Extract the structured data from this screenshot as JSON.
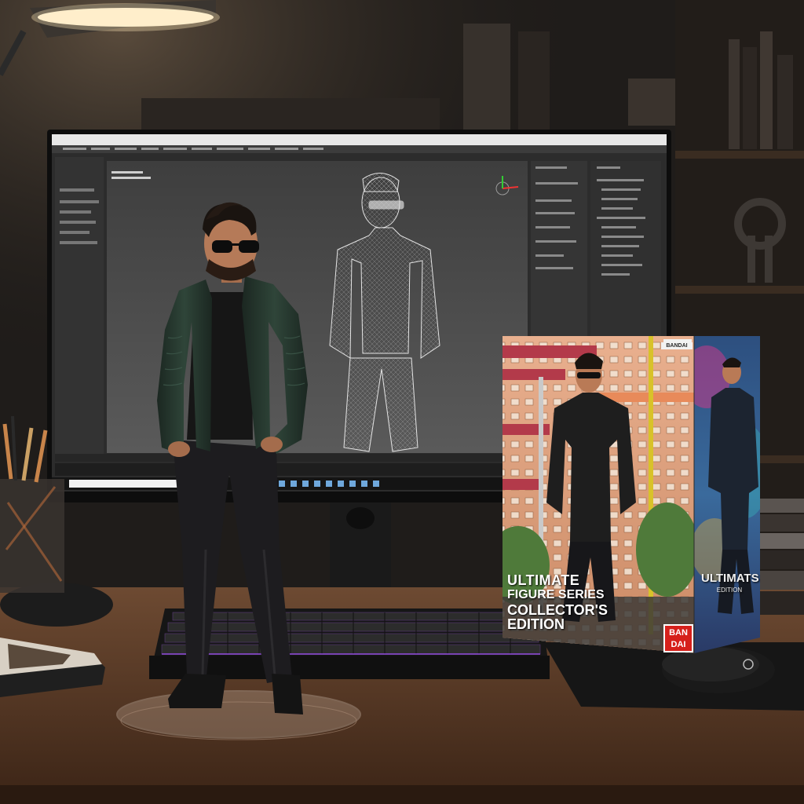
{
  "box": {
    "front_line_1": "ULTIMATE",
    "front_line_2": "FIGURE SERIES",
    "front_line_3": "COLLECTOR'S EDITION",
    "brand_line_1": "BAN",
    "brand_line_2": "DAI",
    "side_title": "ULTIMATS",
    "side_subtitle": "EDITION",
    "top_label": "BANDAI"
  },
  "colors": {
    "wall": "#1f1c1a",
    "desk": "#5a3c28",
    "screen_bg": "#2c2c2c",
    "viewport": "#4a4a4a",
    "jacket": "#27392f",
    "brand_red": "#d6201b",
    "lamp_glow": "#fff2d6"
  },
  "icons": [
    "desk-lamp",
    "pencil-cup",
    "keyboard",
    "mouse",
    "book-stack"
  ]
}
